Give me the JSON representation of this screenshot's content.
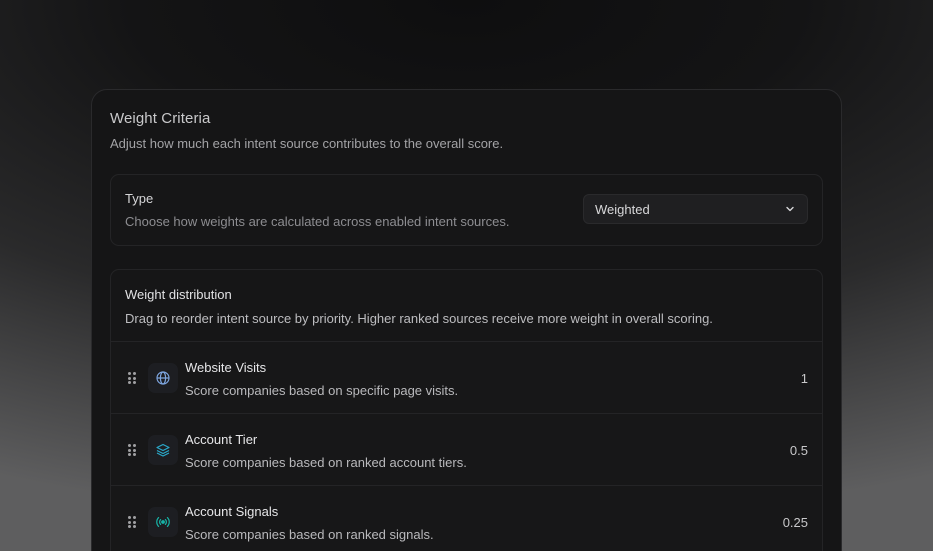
{
  "panel": {
    "title": "Weight Criteria",
    "subtitle": "Adjust how much each intent source contributes to the overall score."
  },
  "type_section": {
    "label": "Type",
    "description": "Choose how weights are calculated across enabled intent sources.",
    "select_value": "Weighted",
    "select_icon": "chevron-down-icon"
  },
  "distribution": {
    "title": "Weight distribution",
    "description": "Drag to reorder intent source by priority. Higher ranked sources receive more weight in overall scoring.",
    "items": [
      {
        "name": "Website Visits",
        "description": "Score companies based on specific page visits.",
        "value": "1",
        "icon": "globe-icon",
        "icon_color": "#7ea6e0"
      },
      {
        "name": "Account Tier",
        "description": "Score companies based on ranked account tiers.",
        "value": "0.5",
        "icon": "layers-icon",
        "icon_color": "#2aa8c9"
      },
      {
        "name": "Account Signals",
        "description": "Score companies based on ranked signals.",
        "value": "0.25",
        "icon": "signal-icon",
        "icon_color": "#17b3a6"
      }
    ]
  }
}
